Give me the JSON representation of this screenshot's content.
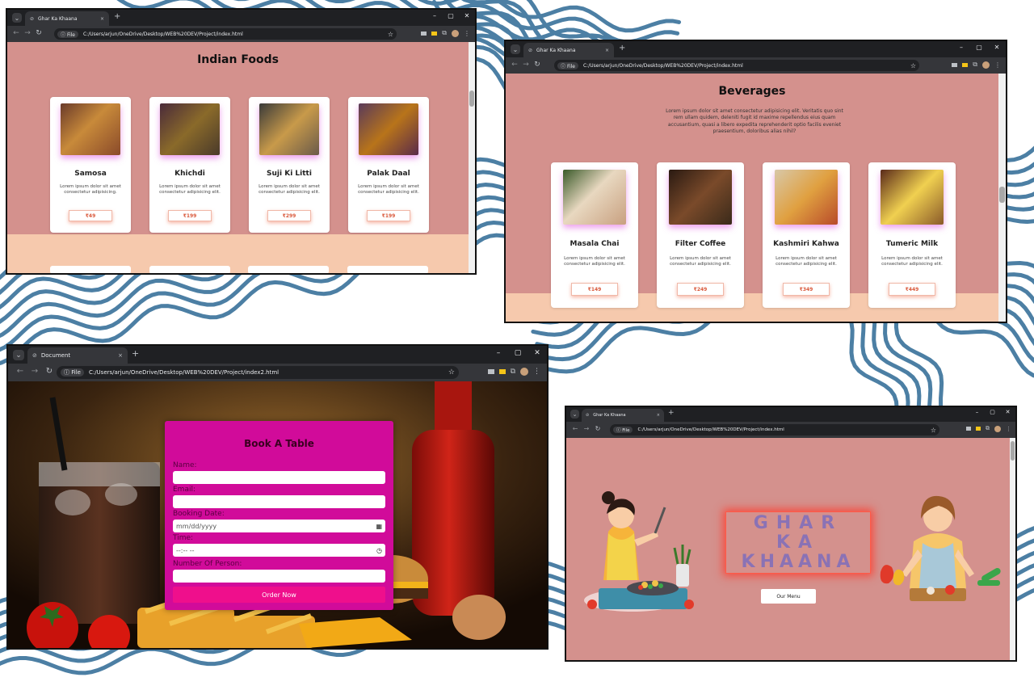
{
  "colors": {
    "page_bg": "#d4918d",
    "peach_band": "#f6c9ad",
    "accent_price": "#d9583a",
    "booking_card": "#d10b9a",
    "booking_button": "#ef0f8c",
    "hero_title": "#8a72b5",
    "hero_glow": "#ff3a2a",
    "pattern_stroke": "#4c7fa4"
  },
  "windows": {
    "foods": {
      "tab_title": "Ghar Ka Khaana",
      "file_chip": "File",
      "url": "C:/Users/arjun/OneDrive/Desktop/WEB%20DEV/Project/index.html",
      "heading": "Indian Foods",
      "items": [
        {
          "name": "Samosa",
          "desc": "Lorem ipsum dolor sit amet consectetur adipisicing.",
          "price": "₹49"
        },
        {
          "name": "Khichdi",
          "desc": "Lorem ipsum dolor sit amet consectetur adipisicing elit.",
          "price": "₹199"
        },
        {
          "name": "Suji Ki Litti",
          "desc": "Lorem ipsum dolor sit amet consectetur adipisicing elit.",
          "price": "₹299"
        },
        {
          "name": "Palak Daal",
          "desc": "Lorem ipsum dolor sit amet consectetur adipisicing elit.",
          "price": "₹199"
        }
      ]
    },
    "beverages": {
      "tab_title": "Ghar Ka Khaana",
      "file_chip": "File",
      "url": "C:/Users/arjun/OneDrive/Desktop/WEB%20DEV/Project/index.html",
      "heading": "Beverages",
      "intro": "Lorem ipsum dolor sit amet consectetur adipisicing elit. Veritatis quo sint rem ullam quidem, deleniti fugit id maxime repellendus eius quam accusantium, quasi a libero expedita reprehenderit optio facilis eveniet praesentium, doloribus alias nihil?",
      "items": [
        {
          "name": "Masala Chai",
          "desc": "Lorem ipsum dolor sit amet consectetur adipisicing elit.",
          "price": "₹149"
        },
        {
          "name": "Filter Coffee",
          "desc": "Lorem ipsum dolor sit amet consectetur adipisicing elit.",
          "price": "₹249"
        },
        {
          "name": "Kashmiri Kahwa",
          "desc": "Lorem ipsum dolor sit amet consectetur adipisicing elit.",
          "price": "₹349"
        },
        {
          "name": "Tumeric Milk",
          "desc": "Lorem ipsum dolor sit amet consectetur adipisicing elit.",
          "price": "₹449"
        }
      ]
    },
    "booking": {
      "tab_title": "Document",
      "file_chip": "File",
      "url": "C:/Users/arjun/OneDrive/Desktop/WEB%20DEV/Project/index2.html",
      "form_title": "Book A Table",
      "labels": {
        "name": "Name:",
        "email": "Email:",
        "date": "Booking Date:",
        "time": "Time:",
        "persons": "Number Of Person:"
      },
      "date_placeholder": "mm/dd/yyyy",
      "time_placeholder": "--:-- --",
      "submit": "Order Now"
    },
    "home": {
      "tab_title": "Ghar Ka Khaana",
      "file_chip": "File",
      "url": "C:/Users/arjun/OneDrive/Desktop/WEB%20DEV/Project/index.html",
      "hero_lines": [
        "GHAR",
        "KA",
        "KHAANA"
      ],
      "menu_button": "Our Menu"
    }
  },
  "chrome": {
    "close_glyph": "×",
    "new_tab_glyph": "+",
    "minimize_glyph": "–",
    "maximize_glyph": "▢",
    "window_close_glyph": "✕",
    "back_glyph": "←",
    "forward_glyph": "→",
    "reload_glyph": "↻",
    "star_glyph": "☆",
    "menu_glyph": "⋮",
    "dropdown_glyph": "⌄",
    "info_glyph": "ⓘ",
    "calendar_glyph": "▦",
    "clock_glyph": "◷",
    "tab_icon_glyph": "⊘"
  }
}
